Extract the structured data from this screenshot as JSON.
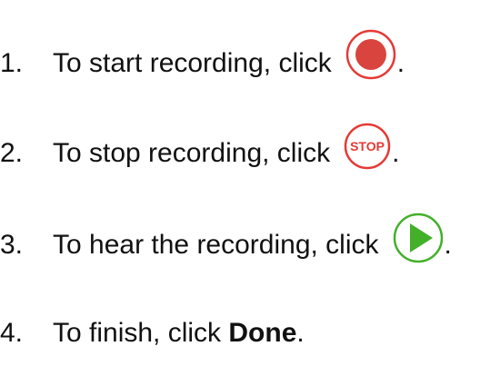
{
  "steps": [
    {
      "number": "1.",
      "text": "To start recording, click",
      "icon": "record-icon",
      "suffix": "."
    },
    {
      "number": "2.",
      "text": "To stop recording, click",
      "icon": "stop-icon",
      "icon_label": "STOP",
      "suffix": "."
    },
    {
      "number": "3.",
      "text": "To hear the recording, click",
      "icon": "play-icon",
      "suffix": "."
    },
    {
      "number": "4.",
      "text": "To finish, click ",
      "bold": "Done",
      "suffix": "."
    }
  ],
  "colors": {
    "record": "#d9443f",
    "stop": "#e53935",
    "play": "#43b02a",
    "text": "#111111"
  }
}
